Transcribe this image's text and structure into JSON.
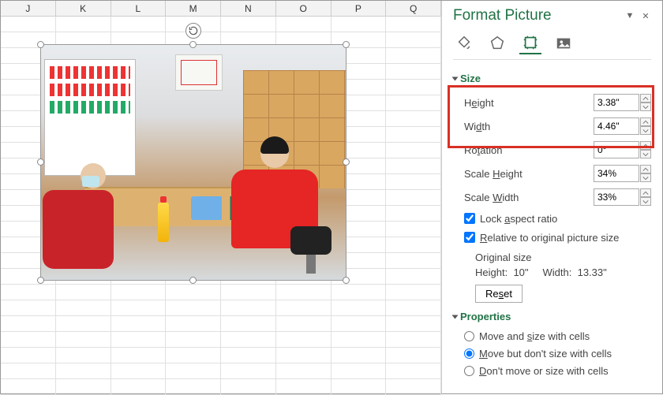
{
  "columns": [
    "J",
    "K",
    "L",
    "M",
    "N",
    "O",
    "P",
    "Q"
  ],
  "panel": {
    "title": "Format Picture",
    "sections": {
      "size": {
        "title": "Size",
        "height_label": "Height",
        "height_value": "3.38\"",
        "width_label": "Width",
        "width_value": "4.46\"",
        "rotation_label": "Rotation",
        "rotation_value": "0°",
        "scale_h_label": "Scale Height",
        "scale_h_value": "34%",
        "scale_w_label": "Scale Width",
        "scale_w_value": "33%",
        "lock_label": "Lock aspect ratio",
        "relative_label": "Relative to original picture size",
        "orig_size_label": "Original size",
        "orig_h_label": "Height:",
        "orig_h_value": "10\"",
        "orig_w_label": "Width:",
        "orig_w_value": "13.33\"",
        "reset_label": "Reset"
      },
      "properties": {
        "title": "Properties",
        "opt1": "Move and size with cells",
        "opt2": "Move but don't size with cells",
        "opt3": "Don't move or size with cells"
      }
    }
  }
}
